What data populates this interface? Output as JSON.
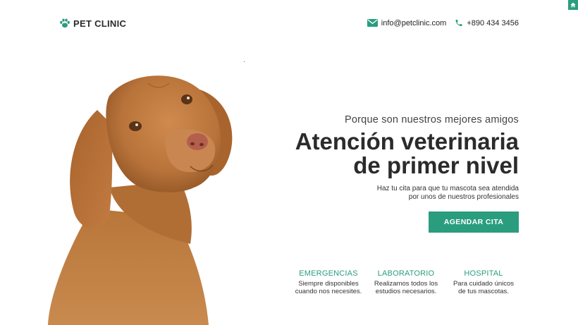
{
  "brand": {
    "name": "PET CLINIC",
    "icon": "paw-icon"
  },
  "contact": {
    "email": "info@petclinic.com",
    "email_icon": "envelope-icon",
    "phone": "+890 434 3456",
    "phone_icon": "phone-icon"
  },
  "hero": {
    "subtitle": "Porque son nuestros mejores amigos",
    "title_line1": "Atención veterinaria",
    "title_line2": "de primer nivel",
    "desc_line1": "Haz tu cita para que tu mascota sea atendida",
    "desc_line2": "por unos de nuestros profesionales",
    "cta_label": "AGENDAR CITA"
  },
  "services": [
    {
      "title": "EMERGENCIAS",
      "line1": "Siempre disponibles",
      "line2": "cuando nos necesites."
    },
    {
      "title": "LABORATORIO",
      "line1": "Realizamos todos los",
      "line2": "estudios necesarios."
    },
    {
      "title": "HOSPITAL",
      "line1": "Para cuidado únicos",
      "line2": "de tus mascotas."
    }
  ],
  "colors": {
    "accent": "#2a9d7f",
    "text_dark": "#2b2b2b",
    "dog_fur": "#c07b3f"
  }
}
